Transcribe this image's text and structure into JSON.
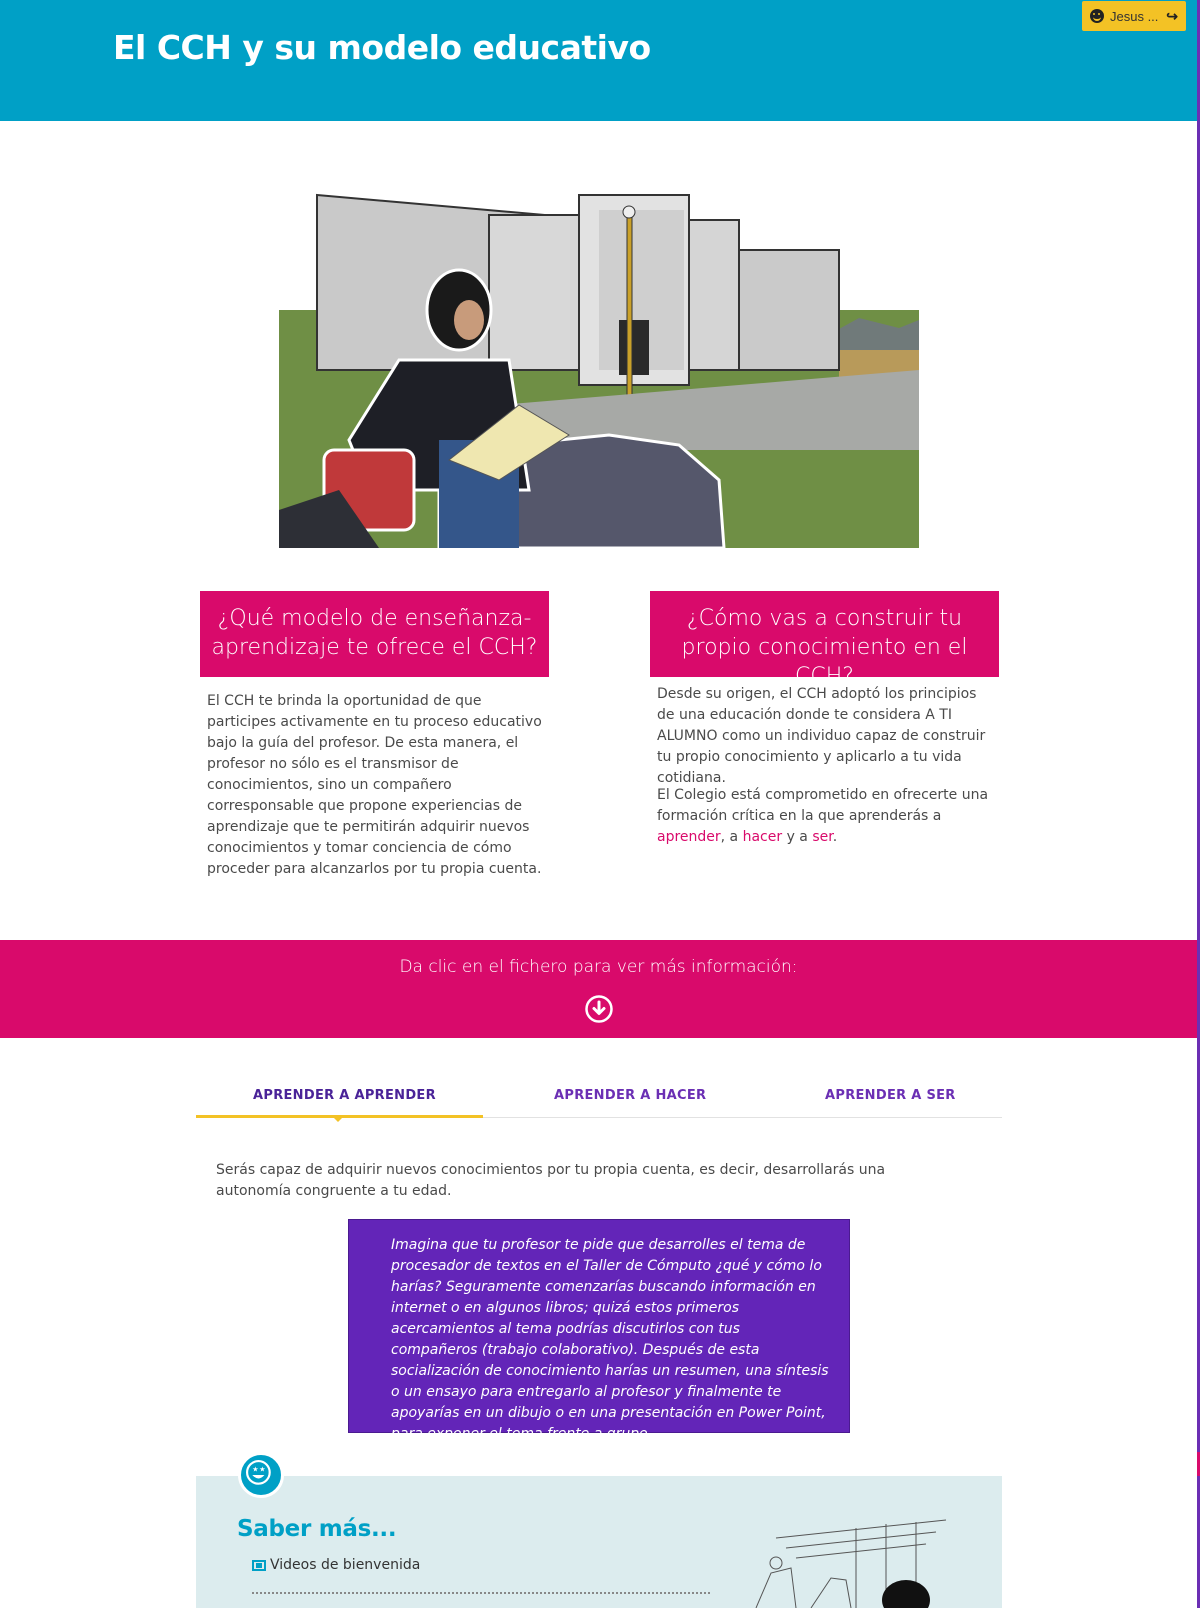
{
  "header": {
    "title": "El CCH y su modelo educativo",
    "user_label": "Jesus ..."
  },
  "sections": {
    "left": {
      "title": "¿Qué modelo de enseñanza-aprendizaje te ofrece el CCH?",
      "text": "El CCH te brinda la oportunidad de que participes activamente en tu proceso educativo bajo la guía del profesor. De esta manera, el profesor no sólo es el transmisor de conocimientos, sino un compañero corresponsable que propone experiencias de aprendizaje que te permitirán adquirir nuevos conocimientos y tomar conciencia de cómo proceder para alcanzarlos por tu propia cuenta."
    },
    "right": {
      "title": "¿Cómo vas a construir tu propio conocimiento en el CCH?",
      "text1": "Desde su origen, el CCH adoptó los principios de una educación donde te considera A TI ALUMNO como un individuo capaz de construir tu propio conocimiento y aplicarlo a tu vida cotidiana.",
      "text2_prefix": "El Colegio está comprometido en ofrecerte una formación crítica en la que aprenderás a ",
      "link_aprender": "aprender",
      "text2_sep1": ", a ",
      "link_hacer": "hacer",
      "text2_sep2": " y a ",
      "link_ser": "ser",
      "text2_suffix": "."
    }
  },
  "band": {
    "message": "Da clic en el fichero para ver más información:"
  },
  "tabs": [
    {
      "label": "APRENDER A APRENDER",
      "active": true
    },
    {
      "label": "APRENDER A HACER",
      "active": false
    },
    {
      "label": "APRENDER A SER",
      "active": false
    }
  ],
  "tab_content": {
    "intro": "Serás capaz de adquirir nuevos conocimientos por tu propia cuenta, es decir, desarrollarás una autonomía congruente a tu edad.",
    "example": "Imagina que tu profesor te pide que desarrolles el tema de procesador de textos en el Taller de Cómputo ¿qué y cómo lo harías? Seguramente comenzarías buscando información en internet o en algunos libros; quizá estos primeros acercamientos al tema podrías discutirlos con tus compañeros (trabajo colaborativo). Después de esta socialización de conocimiento harías un resumen, una síntesis o un ensayo para entregarlo al profesor y finalmente te apoyarías en un dibujo o en una presentación en Power Point, para exponer el tema frente a grupo."
  },
  "saber_mas": {
    "title": "Saber más...",
    "items": [
      {
        "label": "Videos de bienvenida",
        "icon": "film-icon"
      }
    ]
  },
  "colors": {
    "header": "#00a0c6",
    "accent_pink": "#d90a6b",
    "accent_purple": "#6325b8",
    "tab_underline": "#f3c225",
    "saber_bg": "#dcecee"
  }
}
